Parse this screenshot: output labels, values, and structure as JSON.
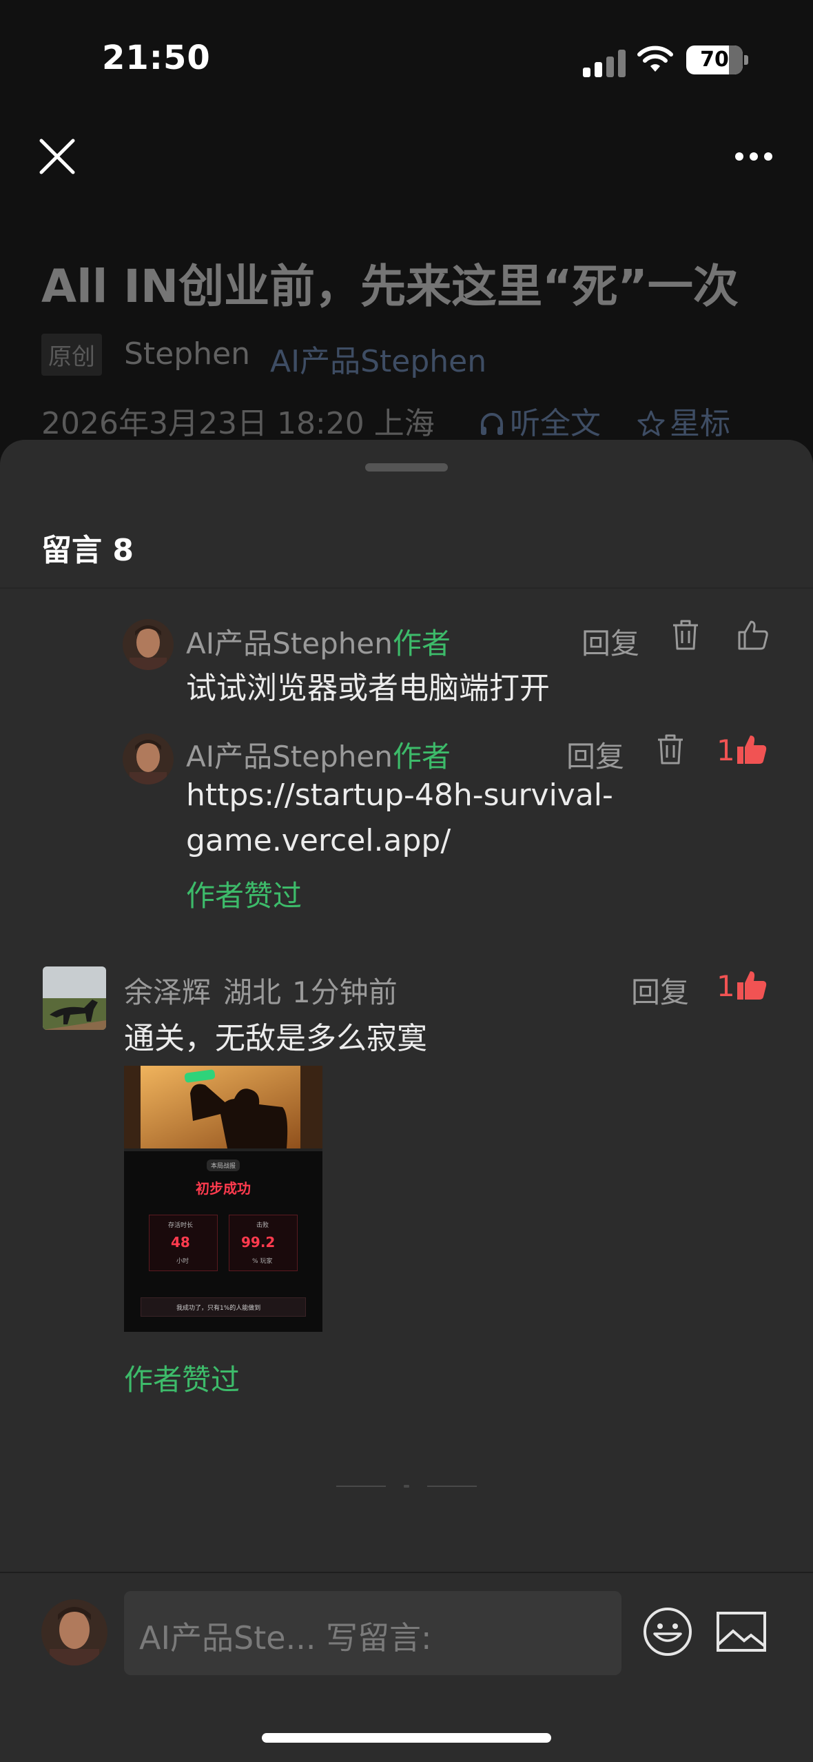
{
  "status_bar": {
    "time": "21:50",
    "battery": "70"
  },
  "article": {
    "title": "All IN创业前，先来这里“死”一次",
    "badge": "原创",
    "author": "Stephen",
    "account": "AI产品Stephen",
    "date_location": "2026年3月23日 18:20  上海",
    "listen_label": "听全文",
    "star_label": "星标"
  },
  "sheet": {
    "title": "留言 8"
  },
  "replies": [
    {
      "user": "AI产品Stephen",
      "tag": "作者",
      "text": "试试浏览器或者电脑端打开",
      "reply_label": "回复"
    },
    {
      "user": "AI产品Stephen",
      "tag": "作者",
      "text_line1": "https://startup-48h-survival-",
      "text_line2": "game.vercel.app/",
      "reply_label": "回复",
      "likes": "1",
      "liked_by": "作者赞过"
    }
  ],
  "comment": {
    "user": "余泽辉",
    "location": "湖北",
    "time": "1分钟前",
    "text": "通关，无敌是多么寂寞",
    "reply_label": "回复",
    "likes": "1",
    "liked_by": "作者赞过",
    "image": {
      "pill": "本局战报",
      "headline": "初步成功",
      "stat1_label": "存活时长",
      "stat1_value": "48",
      "stat1_unit": "小时",
      "stat2_label": "击败",
      "stat2_value": "99.2",
      "stat2_unit": "% 玩家",
      "footer": "我成功了，只有1%的人能做到"
    }
  },
  "input": {
    "placeholder": "AI产品Ste...  写留言:"
  }
}
